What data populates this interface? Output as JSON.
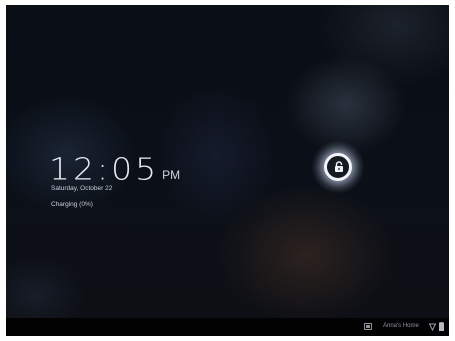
{
  "lockscreen": {
    "time": "12:05",
    "ampm": "PM",
    "date": "Saturday, October 22",
    "charging_status": "Charging (0%)"
  },
  "unlock": {
    "icon": "lock-icon"
  },
  "system_bar": {
    "notification_icon": "notification-icon",
    "label": "Anna's Home",
    "wifi_icon": "wifi-icon",
    "battery_icon": "battery-icon",
    "battery_level_percent": 0
  },
  "colors": {
    "background": "#05080d",
    "text": "#e8ebf0",
    "system_bar": "#020203"
  }
}
